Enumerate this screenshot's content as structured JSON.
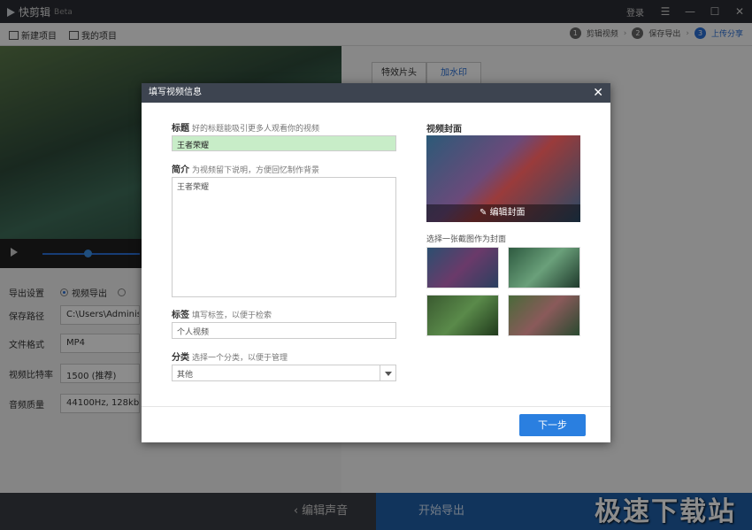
{
  "app": {
    "name": "快剪辑",
    "badge": "Beta",
    "login": "登录"
  },
  "toolbar": {
    "new_project": "新建项目",
    "my_projects": "我的项目"
  },
  "steps": [
    {
      "num": "1",
      "label": "剪辑视频"
    },
    {
      "num": "2",
      "label": "保存导出"
    },
    {
      "num": "3",
      "label": "上传分享"
    }
  ],
  "settings": {
    "export_label": "导出设置",
    "export_option": "视频导出",
    "save_path_label": "保存路径",
    "save_path_value": "C:\\Users\\Administr",
    "format_label": "文件格式",
    "format_value": "MP4",
    "bitrate_label": "视频比特率",
    "bitrate_value": "1500 (推荐)",
    "audio_label": "音频质量",
    "audio_value": "44100Hz, 128kbps"
  },
  "tabs": [
    "特效片头",
    "加水印"
  ],
  "bottom": {
    "edit_audio": "编辑声音",
    "start_export": "开始导出"
  },
  "watermark": "极速下载站",
  "dialog": {
    "title": "填写视频信息",
    "title_label": "标题",
    "title_hint": "好的标题能吸引更多人观看你的视频",
    "title_value": "王者荣耀",
    "intro_label": "简介",
    "intro_hint": "为视频留下说明，方便回忆制作背景",
    "intro_value": "王者荣耀",
    "tags_label": "标签",
    "tags_hint": "填写标签，以便于检索",
    "tags_value": "个人视频",
    "category_label": "分类",
    "category_hint": "选择一个分类，以便于管理",
    "category_value": "其他",
    "cover_label": "视频封面",
    "cover_edit": "编辑封面",
    "pick_cover": "选择一张截图作为封面",
    "next_button": "下一步"
  }
}
